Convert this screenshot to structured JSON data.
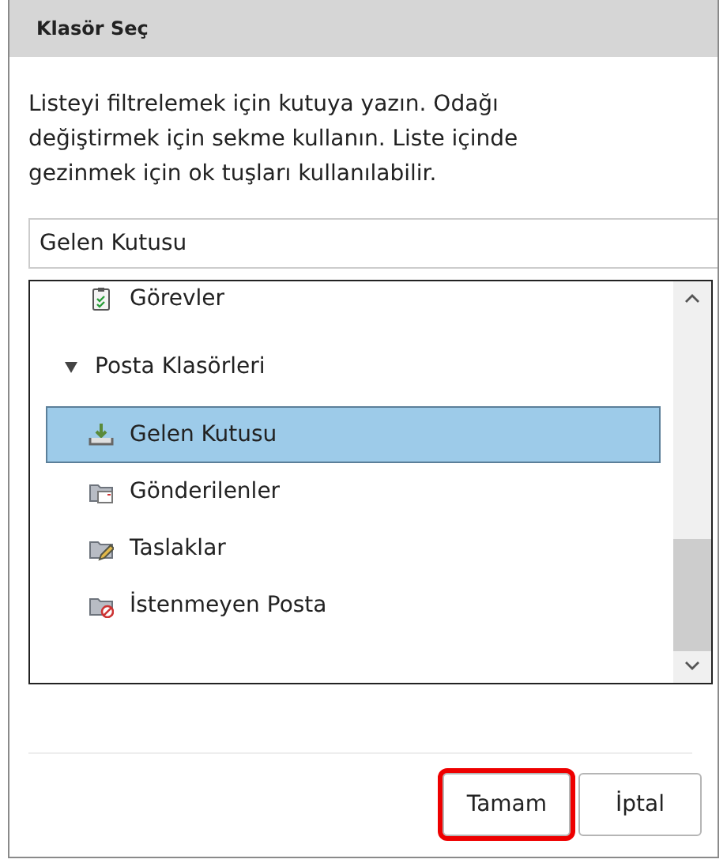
{
  "window": {
    "title": "Klasör Seç"
  },
  "instructions": "Listeyi filtrelemek için kutuya yazın. Odağı değiştirmek için sekme kullanın. Liste içinde gezinmek için ok tuşları kullanılabilir.",
  "filter": {
    "value": "Gelen Kutusu"
  },
  "folders": [
    {
      "label": "Görevler",
      "kind": "tasks",
      "selected": false
    },
    {
      "label": "Posta Klasörleri",
      "expanded": true,
      "selected": false,
      "children": [
        {
          "label": "Gelen Kutusu",
          "kind": "inbox",
          "selected": true
        },
        {
          "label": "Gönderilenler",
          "kind": "sent",
          "selected": false
        },
        {
          "label": "Taslaklar",
          "kind": "drafts",
          "selected": false
        },
        {
          "label": "İstenmeyen Posta",
          "kind": "junk",
          "selected": false
        }
      ]
    }
  ],
  "buttons": [
    {
      "label": "Tamam",
      "focused": true
    },
    {
      "label": "İptal",
      "focused": false
    }
  ]
}
